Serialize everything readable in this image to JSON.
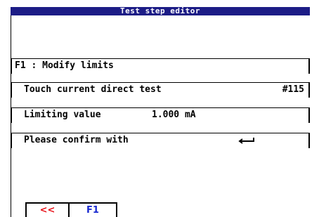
{
  "window": {
    "title": "Test step editor"
  },
  "editor": {
    "heading": "F1 : Modify limits",
    "touch_label": "Touch current direct test",
    "touch_value": "#115",
    "limit_label": "Limiting value",
    "limit_value": "1.000 mA",
    "confirm_label": "Please confirm with",
    "confirm_icon": "enter-return-icon"
  },
  "softkeys": {
    "back_label": "<<",
    "f1_label": "F1"
  },
  "colors": {
    "title_bar": "#1c1c86",
    "back_key": "#e8141b",
    "f1_key": "#1a2ad0"
  }
}
